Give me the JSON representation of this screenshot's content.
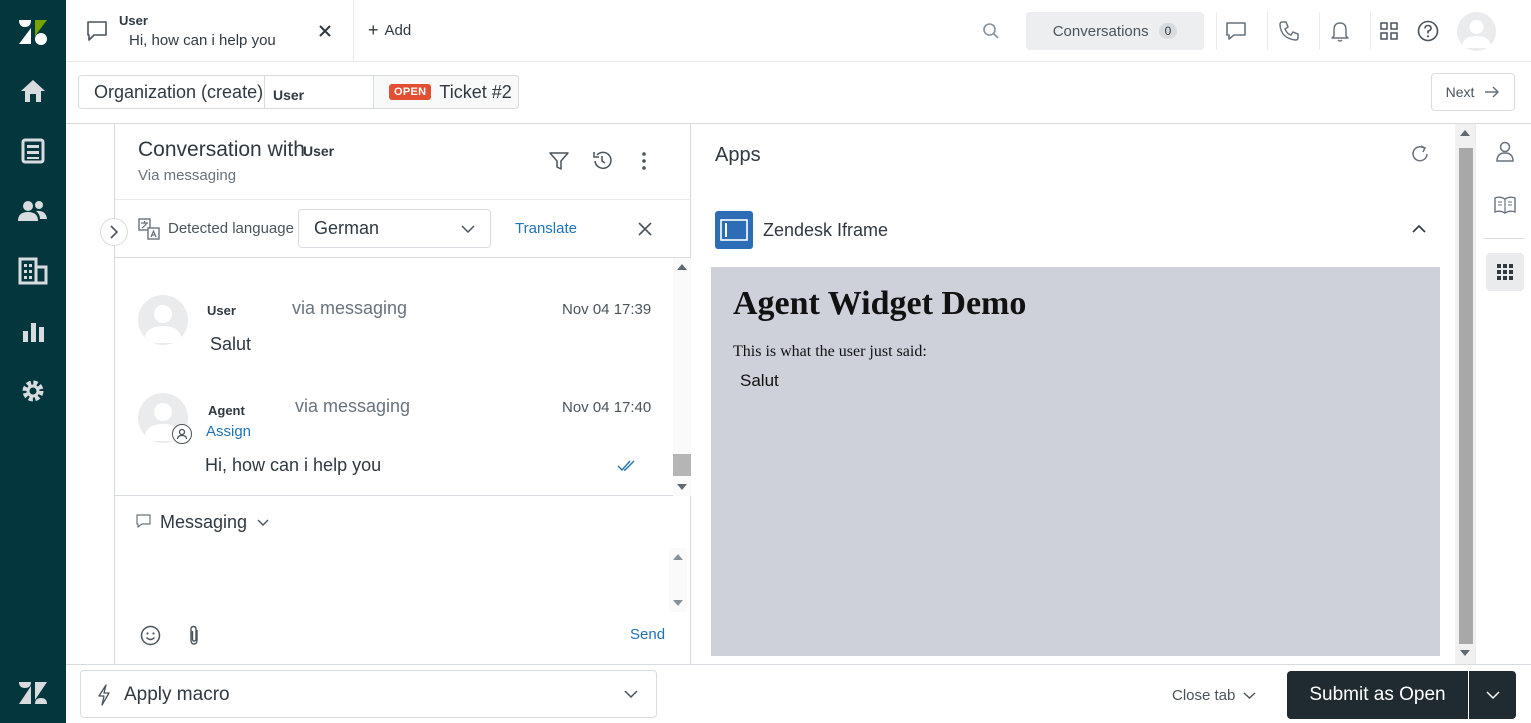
{
  "top_tab": {
    "user": "User",
    "preview": "Hi, how can i help you",
    "add_label": "Add"
  },
  "header": {
    "conversations_label": "Conversations",
    "conversations_count": "0"
  },
  "ticket_bar": {
    "organization": "Organization (create)",
    "user": "User",
    "status": "OPEN",
    "ticket": "Ticket #2",
    "next_label": "Next"
  },
  "conversation": {
    "title": "Conversation with",
    "title_user": "User",
    "subtitle": "Via messaging",
    "detected_language_label": "Detected language",
    "language": "German",
    "translate_label": "Translate",
    "messages": [
      {
        "author": "User",
        "via": "via messaging",
        "time": "Nov 04 17:39",
        "body": "Salut"
      },
      {
        "author": "Agent",
        "assign": "Assign",
        "via": "via messaging",
        "time": "Nov 04 17:40",
        "body": "Hi, how can i help you"
      }
    ],
    "composer_channel": "Messaging",
    "send_label": "Send"
  },
  "apps": {
    "title": "Apps",
    "app_name": "Zendesk Iframe",
    "widget_title": "Agent Widget Demo",
    "widget_text": "This is what the user just said:",
    "widget_said": "Salut"
  },
  "footer": {
    "macro_label": "Apply macro",
    "close_tab_label": "Close tab",
    "submit_label": "Submit as Open"
  },
  "colors": {
    "nav_bg": "#03363d",
    "open_status": "#e34f32",
    "link": "#1f73b7",
    "submit_bg": "#1f2b30"
  }
}
